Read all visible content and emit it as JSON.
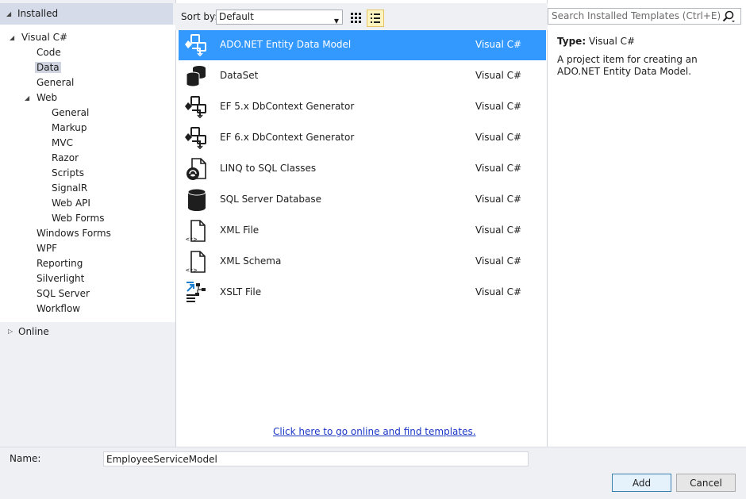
{
  "tree": {
    "installed": "Installed",
    "items": [
      {
        "label": "Visual C#",
        "level": 0,
        "expanded": true
      },
      {
        "label": "Code",
        "level": 1
      },
      {
        "label": "Data",
        "level": 1,
        "selected": true
      },
      {
        "label": "General",
        "level": 1
      },
      {
        "label": "Web",
        "level": 1,
        "expanded": true
      },
      {
        "label": "General",
        "level": 2
      },
      {
        "label": "Markup",
        "level": 2
      },
      {
        "label": "MVC",
        "level": 2
      },
      {
        "label": "Razor",
        "level": 2
      },
      {
        "label": "Scripts",
        "level": 2
      },
      {
        "label": "SignalR",
        "level": 2
      },
      {
        "label": "Web API",
        "level": 2
      },
      {
        "label": "Web Forms",
        "level": 2
      },
      {
        "label": "Windows Forms",
        "level": 1
      },
      {
        "label": "WPF",
        "level": 1
      },
      {
        "label": "Reporting",
        "level": 1
      },
      {
        "label": "Silverlight",
        "level": 1
      },
      {
        "label": "SQL Server",
        "level": 1
      },
      {
        "label": "Workflow",
        "level": 1
      }
    ],
    "online": "Online"
  },
  "toolbar": {
    "sort_label": "Sort by:",
    "sort_value": "Default"
  },
  "search": {
    "placeholder": "Search Installed Templates (Ctrl+E)"
  },
  "templates": [
    {
      "name": "ADO.NET Entity Data Model",
      "lang": "Visual C#",
      "icon": "entity-model-icon",
      "selected": true
    },
    {
      "name": "DataSet",
      "lang": "Visual C#",
      "icon": "dataset-icon"
    },
    {
      "name": "EF 5.x DbContext Generator",
      "lang": "Visual C#",
      "icon": "entity-model-icon"
    },
    {
      "name": "EF 6.x DbContext Generator",
      "lang": "Visual C#",
      "icon": "entity-model-icon"
    },
    {
      "name": "LINQ to SQL Classes",
      "lang": "Visual C#",
      "icon": "linq-icon"
    },
    {
      "name": "SQL Server Database",
      "lang": "Visual C#",
      "icon": "database-icon"
    },
    {
      "name": "XML File",
      "lang": "Visual C#",
      "icon": "xml-file-icon"
    },
    {
      "name": "XML Schema",
      "lang": "Visual C#",
      "icon": "xml-file-icon"
    },
    {
      "name": "XSLT File",
      "lang": "Visual C#",
      "icon": "xslt-icon"
    }
  ],
  "online_link": "Click here to go online and find templates.",
  "details": {
    "type_label": "Type:",
    "type_value": "Visual C#",
    "description": "A project item for creating an ADO.NET Entity Data Model."
  },
  "name_field": {
    "label": "Name:",
    "value": "EmployeeServiceModel"
  },
  "buttons": {
    "add": "Add",
    "cancel": "Cancel"
  },
  "colors": {
    "selection": "#3399ff",
    "link": "#1a37c6",
    "pane_bg": "#eef0f4"
  }
}
